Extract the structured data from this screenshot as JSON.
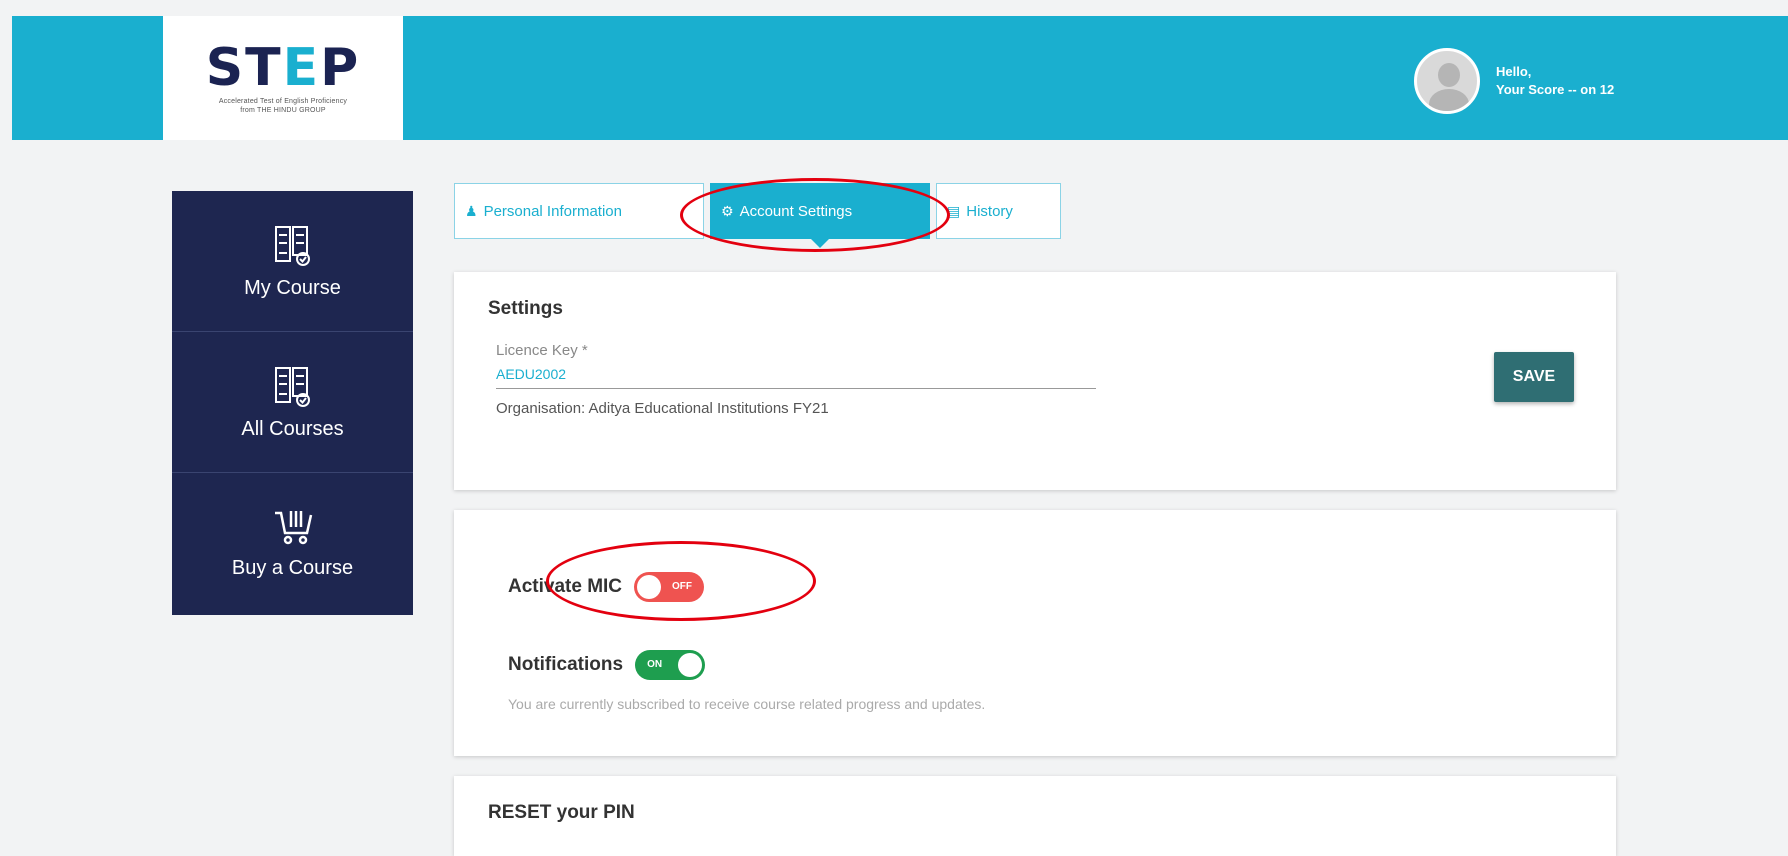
{
  "header": {
    "logo_text": "STEP",
    "logo_tagline": "Accelerated Test of English Proficiency",
    "logo_subtitle": "from THE HINDU GROUP",
    "greeting": "Hello,",
    "score": "Your Score -- on 12"
  },
  "sidebar": {
    "items": [
      {
        "label": "My Course",
        "icon": "book-check-icon"
      },
      {
        "label": "All Courses",
        "icon": "book-check-icon"
      },
      {
        "label": "Buy a Course",
        "icon": "cart-icon"
      }
    ]
  },
  "tabs": [
    {
      "label": "Personal Information",
      "icon": "user-icon",
      "active": false
    },
    {
      "label": "Account Settings",
      "icon": "cogs-icon",
      "active": true
    },
    {
      "label": "History",
      "icon": "file-icon",
      "active": false
    }
  ],
  "settings": {
    "title": "Settings",
    "license_label": "Licence Key *",
    "license_value": "AEDU2002",
    "organisation": "Organisation: Aditya Educational Institutions FY21",
    "save_label": "SAVE"
  },
  "toggles": {
    "mic_label": "Activate MIC",
    "mic_state": "OFF",
    "notifications_label": "Notifications",
    "notifications_state": "ON",
    "notifications_desc": "You are currently subscribed to receive course related progress and updates."
  },
  "reset": {
    "title": "RESET your PIN"
  },
  "colors": {
    "header": "#1aafcf",
    "sidebar": "#1e2650",
    "save": "#2f6e73",
    "off": "#ef5350",
    "on": "#1e9e4f",
    "annotation": "#e3000f"
  }
}
